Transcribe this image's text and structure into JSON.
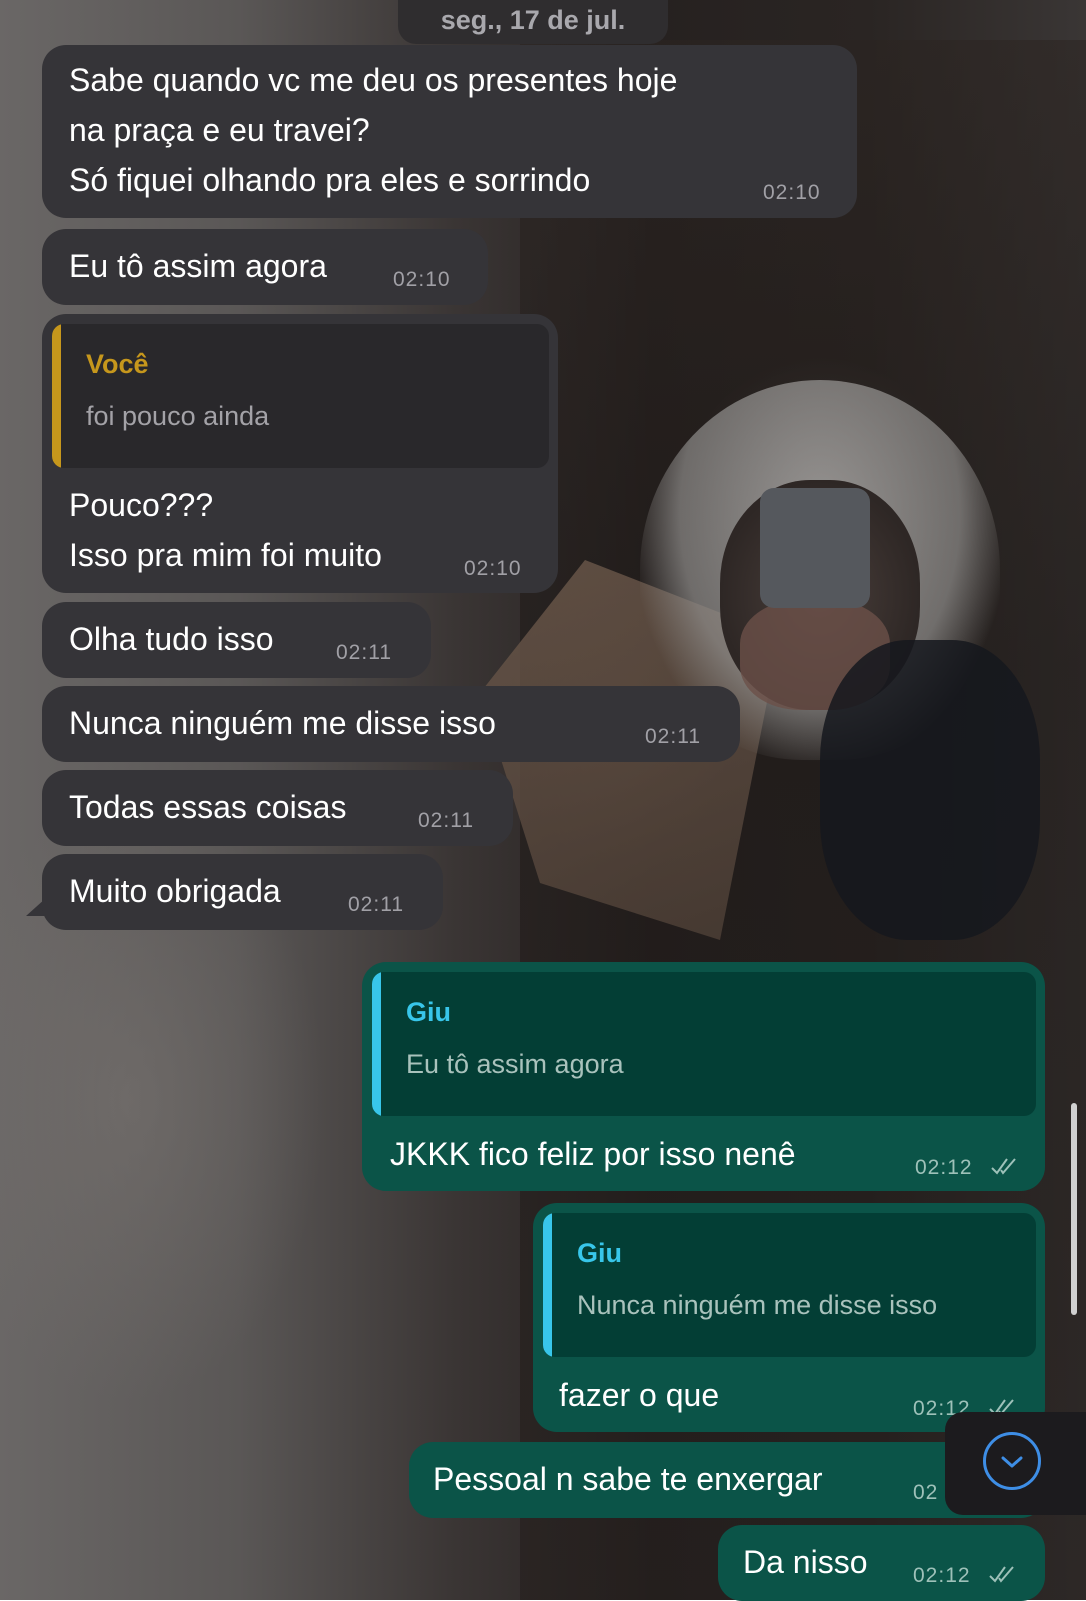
{
  "date_separator": "seg., 17 de jul.",
  "colors": {
    "incoming_bubble": "#353438",
    "outgoing_bubble": "#0b5448",
    "quote_you": "#c6971c",
    "quote_other": "#38c6ea",
    "scroll_button_accent": "#3e8ee6"
  },
  "messages": [
    {
      "direction": "in",
      "lines": [
        "Sabe quando vc me deu os presentes hoje",
        "na praça e eu travei?",
        "Só fiquei olhando pra eles e sorrindo"
      ],
      "time": "02:10"
    },
    {
      "direction": "in",
      "text": "Eu tô assim agora",
      "time": "02:10"
    },
    {
      "direction": "in",
      "reply_to": {
        "name": "Você",
        "text": "foi pouco ainda"
      },
      "lines": [
        "Pouco???",
        "Isso pra mim foi muito"
      ],
      "time": "02:10"
    },
    {
      "direction": "in",
      "text": "Olha tudo isso",
      "time": "02:11"
    },
    {
      "direction": "in",
      "text": "Nunca ninguém me disse isso",
      "time": "02:11"
    },
    {
      "direction": "in",
      "text": "Todas essas coisas",
      "time": "02:11"
    },
    {
      "direction": "in",
      "text": "Muito obrigada",
      "time": "02:11"
    },
    {
      "direction": "out",
      "reply_to": {
        "name": "Giu",
        "text": "Eu tô assim agora"
      },
      "text": "JKKK fico feliz por isso nenê",
      "time": "02:12",
      "status": "read-double-tick-icon"
    },
    {
      "direction": "out",
      "reply_to": {
        "name": "Giu",
        "text": "Nunca ninguém me disse isso"
      },
      "text": "fazer o que",
      "time": "02:12",
      "status": "read-double-tick-icon"
    },
    {
      "direction": "out",
      "text": "Pessoal n sabe te enxergar",
      "time": "02",
      "status": "time partially hidden by scroll button"
    },
    {
      "direction": "out",
      "text": "Da nisso",
      "time": "02:12",
      "status": "read-double-tick-icon"
    }
  ],
  "scroll_down_button": {
    "icon": "chevron-down-circle-icon"
  }
}
